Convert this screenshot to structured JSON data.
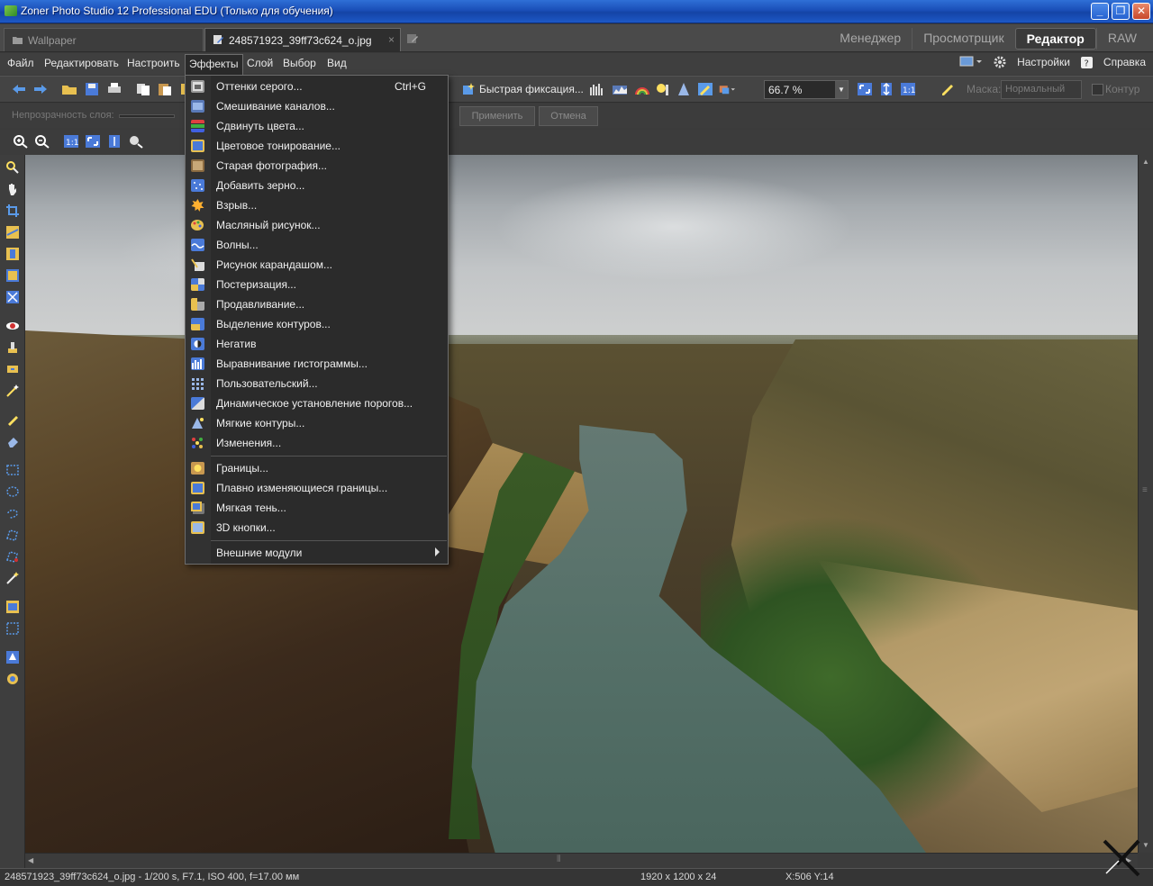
{
  "window": {
    "title": "Zoner Photo Studio 12 Professional EDU (Только для обучения)",
    "minimize": "_",
    "maximize": "❐",
    "close": "✕"
  },
  "tabs": {
    "wallpaper": "Wallpaper",
    "active_doc": "248571923_39ff73c624_o.jpg",
    "close_glyph": "×"
  },
  "modes": [
    "Менеджер",
    "Просмотрщик",
    "Редактор",
    "RAW"
  ],
  "menu": {
    "items": [
      "Файл",
      "Редактировать",
      "Настроить",
      "Эффекты",
      "Слой",
      "Выбор",
      "Вид"
    ],
    "settings": "Настройки",
    "help": "Справка"
  },
  "toolbar": {
    "quick_fix": "Быстрая фиксация...",
    "zoom": "66.7 %",
    "mask_label": "Маска:",
    "mask_value": "Нормальный",
    "contour": "Контур"
  },
  "options": {
    "opacity_label": "Непрозрачность слоя:",
    "apply": "Применить",
    "cancel": "Отмена"
  },
  "effects_menu": {
    "items": [
      {
        "label": "Оттенки серого...",
        "shortcut": "Ctrl+G",
        "icon": "grayscale-icon"
      },
      {
        "label": "Смешивание каналов...",
        "icon": "channel-mixer-icon"
      },
      {
        "label": "Сдвинуть цвета...",
        "icon": "color-shift-icon"
      },
      {
        "label": "Цветовое тонирование...",
        "icon": "color-toning-icon"
      },
      {
        "label": "Старая фотография...",
        "icon": "old-photo-icon"
      },
      {
        "label": "Добавить зерно...",
        "icon": "add-grain-icon"
      },
      {
        "label": "Взрыв...",
        "icon": "explosion-icon"
      },
      {
        "label": "Масляный рисунок...",
        "icon": "oil-painting-icon"
      },
      {
        "label": "Волны...",
        "icon": "waves-icon"
      },
      {
        "label": "Рисунок карандашом...",
        "icon": "pencil-drawing-icon"
      },
      {
        "label": "Постеризация...",
        "icon": "posterize-icon"
      },
      {
        "label": "Продавливание...",
        "icon": "emboss-icon"
      },
      {
        "label": "Выделение контуров...",
        "icon": "edge-detect-icon"
      },
      {
        "label": "Негатив",
        "icon": "negative-icon"
      },
      {
        "label": "Выравнивание гистограммы...",
        "icon": "histogram-equalize-icon"
      },
      {
        "label": "Пользовательский...",
        "icon": "custom-filter-icon"
      },
      {
        "label": "Динамическое установление порогов...",
        "icon": "dynamic-threshold-icon"
      },
      {
        "label": "Мягкие контуры...",
        "icon": "soft-edges-icon"
      },
      {
        "label": "Изменения...",
        "icon": "changes-icon"
      }
    ],
    "items2": [
      {
        "label": "Границы...",
        "icon": "borders-icon"
      },
      {
        "label": "Плавно изменяющиеся границы...",
        "icon": "gradient-borders-icon"
      },
      {
        "label": "Мягкая тень...",
        "icon": "soft-shadow-icon"
      },
      {
        "label": "3D кнопки...",
        "icon": "3d-buttons-icon"
      }
    ],
    "plugins": "Внешние модули"
  },
  "status": {
    "file_info": "248571923_39ff73c624_o.jpg - 1/200 s, F7.1, ISO 400, f=17.00 мм",
    "dimensions": "1920 x 1200 x 24",
    "coords": "X:506  Y:14"
  },
  "colors": {
    "accent_blue": "#1a4fb8",
    "menu_bg": "#2b2b2b",
    "panel_bg": "#3c3c3c"
  }
}
